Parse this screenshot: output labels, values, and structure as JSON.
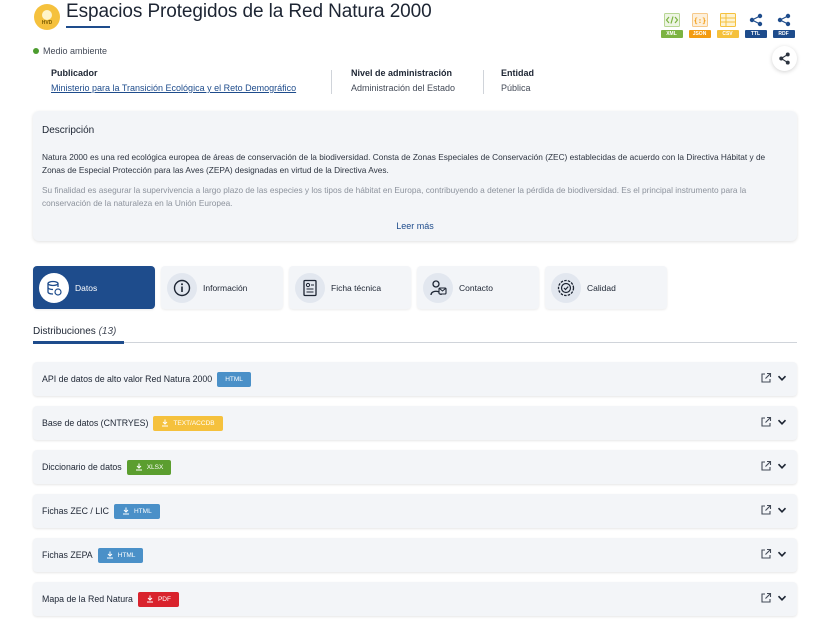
{
  "header": {
    "badge_text": "HVD",
    "title": "Espacios Protegidos de la Red Natura 2000"
  },
  "formats": [
    {
      "label": "XML",
      "icon": "code-icon",
      "color": "#7cb342",
      "glyph": "</>"
    },
    {
      "label": "JSON",
      "icon": "braces-icon",
      "color": "#f39c12",
      "glyph": "{:}"
    },
    {
      "label": "CSV",
      "icon": "table-icon",
      "color": "#f5c13d",
      "glyph": ""
    },
    {
      "label": "TTL",
      "icon": "share-nodes-icon",
      "color": "#1e4c8c",
      "glyph": ""
    },
    {
      "label": "RDF",
      "icon": "share-nodes-icon",
      "color": "#1e4c8c",
      "glyph": ""
    }
  ],
  "category": {
    "label": "Medio ambiente",
    "color": "#4c9c2e"
  },
  "meta": {
    "publisher_heading": "Publicador",
    "publisher_value": "Ministerio para la Transición Ecológica y el Reto Demográfico",
    "admin_heading": "Nivel de administración",
    "admin_value": "Administración del Estado",
    "entity_heading": "Entidad",
    "entity_value": "Pública"
  },
  "description": {
    "heading": "Descripción",
    "p1": "Natura 2000 es una red ecológica europea de áreas de conservación de la biodiversidad. Consta de Zonas Especiales de Conservación (ZEC) establecidas de acuerdo con la Directiva Hábitat y de Zonas de Especial Protección para las Aves (ZEPA) designadas en virtud de la Directiva Aves.",
    "p2": "Su finalidad es asegurar la supervivencia a largo plazo de las especies y los tipos de hábitat en Europa, contribuyendo a detener la pérdida de biodiversidad. Es el principal instrumento para la conservación de la naturaleza en la Unión Europea.",
    "read_more": "Leer más"
  },
  "tabs": [
    {
      "label": "Datos",
      "icon": "database-icon",
      "active": true
    },
    {
      "label": "Información",
      "icon": "info-icon",
      "active": false
    },
    {
      "label": "Ficha técnica",
      "icon": "document-icon",
      "active": false
    },
    {
      "label": "Contacto",
      "icon": "contact-icon",
      "active": false
    },
    {
      "label": "Calidad",
      "icon": "quality-badge-icon",
      "active": false
    }
  ],
  "distributions": {
    "heading": "Distribuciones",
    "count": "(13)",
    "items": [
      {
        "title": "API de datos de alto valor Red Natura 2000",
        "format": "HTML",
        "color": "#4a90c8",
        "download": false
      },
      {
        "title": "Base de datos (CNTRYES)",
        "format": "TEXT/ACCDB",
        "color": "#f5c13d",
        "download": true
      },
      {
        "title": "Diccionario de datos",
        "format": "XLSX",
        "color": "#5b9e2f",
        "download": true
      },
      {
        "title": "Fichas ZEC / LIC",
        "format": "HTML",
        "color": "#4a90c8",
        "download": true
      },
      {
        "title": "Fichas ZEPA",
        "format": "HTML",
        "color": "#4a90c8",
        "download": true
      },
      {
        "title": "Mapa de la Red Natura",
        "format": "PDF",
        "color": "#d9232d",
        "download": true
      }
    ]
  }
}
